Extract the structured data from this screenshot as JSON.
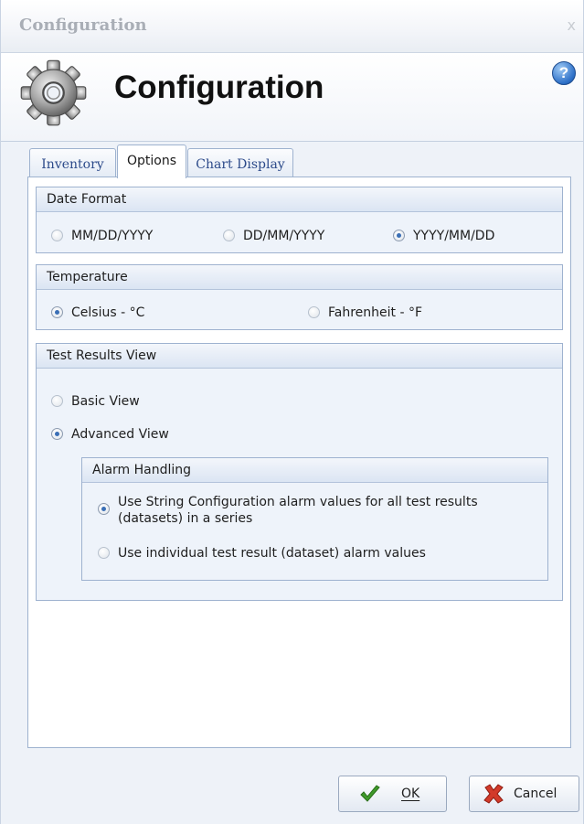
{
  "window": {
    "title": "Configuration",
    "close_glyph": "x",
    "heading": "Configuration",
    "help_glyph": "?",
    "header_icon": "gear-icon"
  },
  "tabs": [
    {
      "label": "Inventory",
      "active": false
    },
    {
      "label": "Options",
      "active": true
    },
    {
      "label": "Chart Display",
      "active": false
    }
  ],
  "date_format": {
    "title": "Date Format",
    "options": [
      {
        "label": "MM/DD/YYYY",
        "checked": false
      },
      {
        "label": "DD/MM/YYYY",
        "checked": false
      },
      {
        "label": "YYYY/MM/DD",
        "checked": true
      }
    ]
  },
  "temperature": {
    "title": "Temperature",
    "options": [
      {
        "label": "Celsius - °C",
        "checked": true
      },
      {
        "label": "Fahrenheit - °F",
        "checked": false
      }
    ]
  },
  "test_results_view": {
    "title": "Test Results View",
    "options": [
      {
        "label": "Basic View",
        "checked": false
      },
      {
        "label": "Advanced View",
        "checked": true
      }
    ],
    "alarm_handling": {
      "title": "Alarm Handling",
      "options": [
        {
          "label": "Use String Configuration alarm values for all test results (datasets) in a series",
          "checked": true
        },
        {
          "label": "Use individual test result (dataset) alarm values",
          "checked": false
        }
      ]
    }
  },
  "buttons": {
    "ok_label": "OK",
    "ok_icon": "checkmark-icon",
    "cancel_label": "Cancel",
    "cancel_icon": "red-x-icon"
  },
  "colors": {
    "group_header": "#dbe5f3",
    "border": "#9eb2cf",
    "radio_dot": "#3b6fb6",
    "ok_check": "#3f9a2a",
    "cancel_x": "#d23a2a"
  }
}
